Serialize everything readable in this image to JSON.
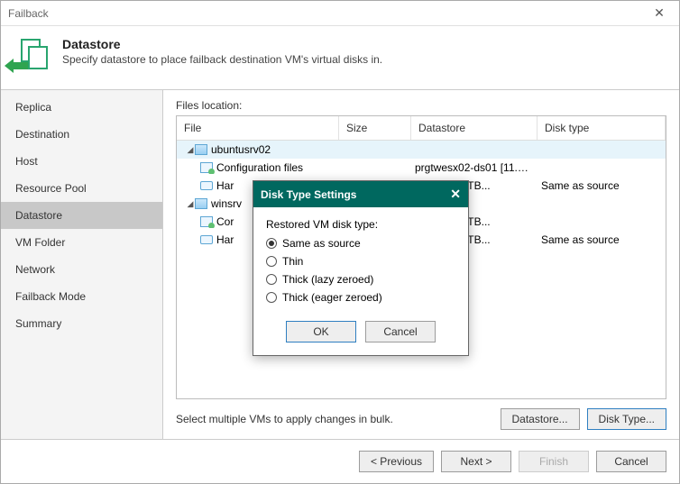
{
  "titlebar": {
    "title": "Failback"
  },
  "header": {
    "title": "Datastore",
    "subtitle": "Specify datastore to place failback destination VM's virtual disks in."
  },
  "sidebar": {
    "items": [
      {
        "label": "Replica"
      },
      {
        "label": "Destination"
      },
      {
        "label": "Host"
      },
      {
        "label": "Resource Pool"
      },
      {
        "label": "Datastore"
      },
      {
        "label": "VM Folder"
      },
      {
        "label": "Network"
      },
      {
        "label": "Failback Mode"
      },
      {
        "label": "Summary"
      }
    ]
  },
  "main": {
    "files_label": "Files location:",
    "columns": {
      "file": "File",
      "size": "Size",
      "datastore": "Datastore",
      "disk": "Disk type"
    },
    "rows": [
      {
        "type": "parent",
        "name": "ubuntusrv02"
      },
      {
        "type": "cfg",
        "name": "Configuration files",
        "datastore": "prgtwesx02-ds01 [11.4 TB..."
      },
      {
        "type": "disk",
        "name": "Har",
        "datastore": "ds01 [11.4 TB...",
        "disk": "Same as source"
      },
      {
        "type": "parent",
        "name": "winsrv"
      },
      {
        "type": "cfg",
        "name": "Cor",
        "datastore": "ds01 [11.4 TB..."
      },
      {
        "type": "disk",
        "name": "Har",
        "datastore": "ds01 [11.4 TB...",
        "disk": "Same as source"
      }
    ],
    "bulk_text": "Select multiple VMs to apply changes in bulk.",
    "datastore_btn": "Datastore...",
    "disktype_btn": "Disk Type..."
  },
  "footer": {
    "prev": "< Previous",
    "next": "Next >",
    "finish": "Finish",
    "cancel": "Cancel"
  },
  "modal": {
    "title": "Disk Type Settings",
    "prompt": "Restored VM disk type:",
    "options": [
      {
        "label": "Same as source",
        "checked": true
      },
      {
        "label": "Thin",
        "checked": false
      },
      {
        "label": "Thick (lazy zeroed)",
        "checked": false
      },
      {
        "label": "Thick (eager zeroed)",
        "checked": false
      }
    ],
    "ok": "OK",
    "cancel": "Cancel"
  }
}
